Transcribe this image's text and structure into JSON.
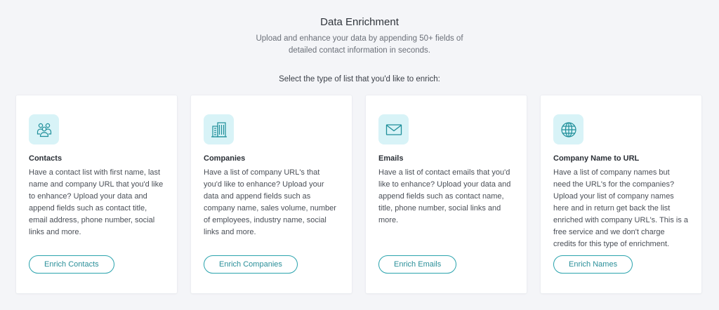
{
  "header": {
    "title": "Data Enrichment",
    "subtitle": "Upload and enhance your data by appending 50+ fields of detailed contact information in seconds."
  },
  "prompt": "Select the type of list that you'd like to enrich:",
  "cards": [
    {
      "icon": "contacts-icon",
      "title": "Contacts",
      "description": "Have a contact list with first name, last name and company URL that you'd like to enhance? Upload your data and append fields such as contact title, email address, phone number, social links and more.",
      "button": "Enrich Contacts"
    },
    {
      "icon": "building-icon",
      "title": "Companies",
      "description": "Have a list of company URL's that you'd like to enhance? Upload your data and append fields such as company name, sales volume, number of employees, industry name, social links and more.",
      "button": "Enrich Companies"
    },
    {
      "icon": "envelope-icon",
      "title": "Emails",
      "description": "Have a list of contact emails that you'd like to enhance? Upload your data and append fields such as contact name, title, phone number, social links and more.",
      "button": "Enrich Emails"
    },
    {
      "icon": "globe-icon",
      "title": "Company Name to URL",
      "description": "Have a list of company names but need the URL's for the companies? Upload your list of company names here and in return get back the list enriched with company URL's. This is a free service and we don't charge credits for this type of enrichment.",
      "button": "Enrich Names"
    }
  ],
  "colors": {
    "accent": "#2aa3ad",
    "icon_bg": "#d8f3f7",
    "page_bg": "#f4f5f8"
  }
}
